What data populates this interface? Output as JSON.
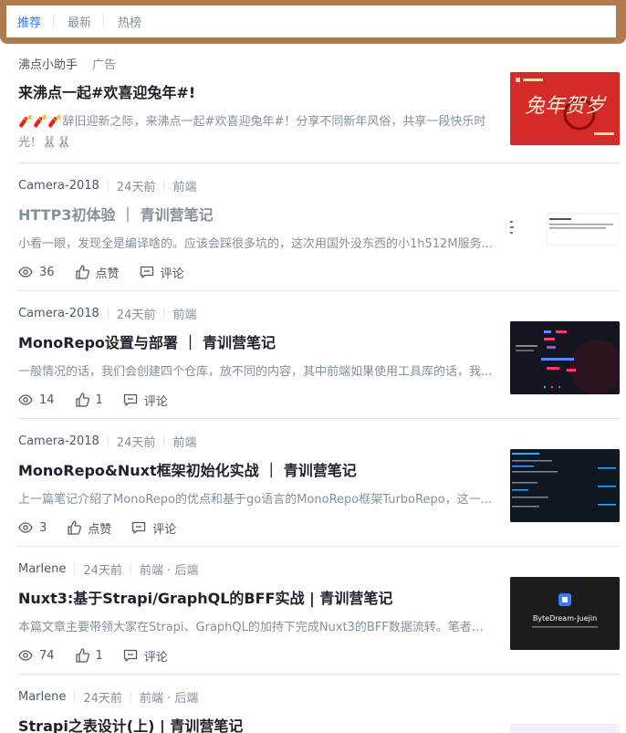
{
  "tabs": [
    {
      "label": "推荐",
      "active": true
    },
    {
      "label": "最新",
      "active": false
    },
    {
      "label": "热榜",
      "active": false
    }
  ],
  "ad_item": {
    "author": "沸点小助手",
    "badge": "广告",
    "title": "来沸点一起#欢喜迎兔年#!",
    "abstract_line1": "🧨🧨🧨辞旧迎新之际，来沸点一起#欢喜迎兔年#！分享不同新年风俗，共享一段快乐时",
    "abstract_line2": "光！🐰🐰",
    "thumb_text": "兔年贺岁"
  },
  "articles": [
    {
      "author": "Camera-2018",
      "time": "24天前",
      "tags": "前端",
      "title": "HTTP3初体验 ｜ 青训营笔记",
      "abstract": "小看一眼，发现全是编译啥的。应该会踩很多坑的，这次用国外没东西的小1h512M服务...",
      "views": "36",
      "likes": "点赞",
      "comments": "评论"
    },
    {
      "author": "Camera-2018",
      "time": "24天前",
      "tags": "前端",
      "title": "MonoRepo设置与部署 ｜ 青训营笔记",
      "abstract": "一般情况的话，我们会创建四个仓库，放不同的内容，其中前端如果使用工具库的话，我...",
      "views": "14",
      "likes": "1",
      "comments": "评论"
    },
    {
      "author": "Camera-2018",
      "time": "24天前",
      "tags": "前端",
      "title": "MonoRepo&Nuxt框架初始化实战 ｜ 青训营笔记",
      "abstract": "上一篇笔记介绍了MonoRepo的优点和基于go语言的MonoRepo框架TurboRepo，这一...",
      "views": "3",
      "likes": "点赞",
      "comments": "评论"
    },
    {
      "author": "Marlene",
      "time": "24天前",
      "tags": "前端 · 后端",
      "title": "Nuxt3:基于Strapi/GraphQL的BFF实战 | 青训营笔记",
      "abstract": "本篇文章主要带领大家在Strapi、GraphQL的加持下完成Nuxt3的BFF数据流转。笔者在...",
      "views": "74",
      "likes": "1",
      "comments": "评论",
      "thumb_text": "ByteDream-Juejin"
    },
    {
      "author": "Marlene",
      "time": "24天前",
      "tags": "前端 · 后端",
      "title": "Strapi之表设计(上) | 青训营笔记"
    }
  ]
}
